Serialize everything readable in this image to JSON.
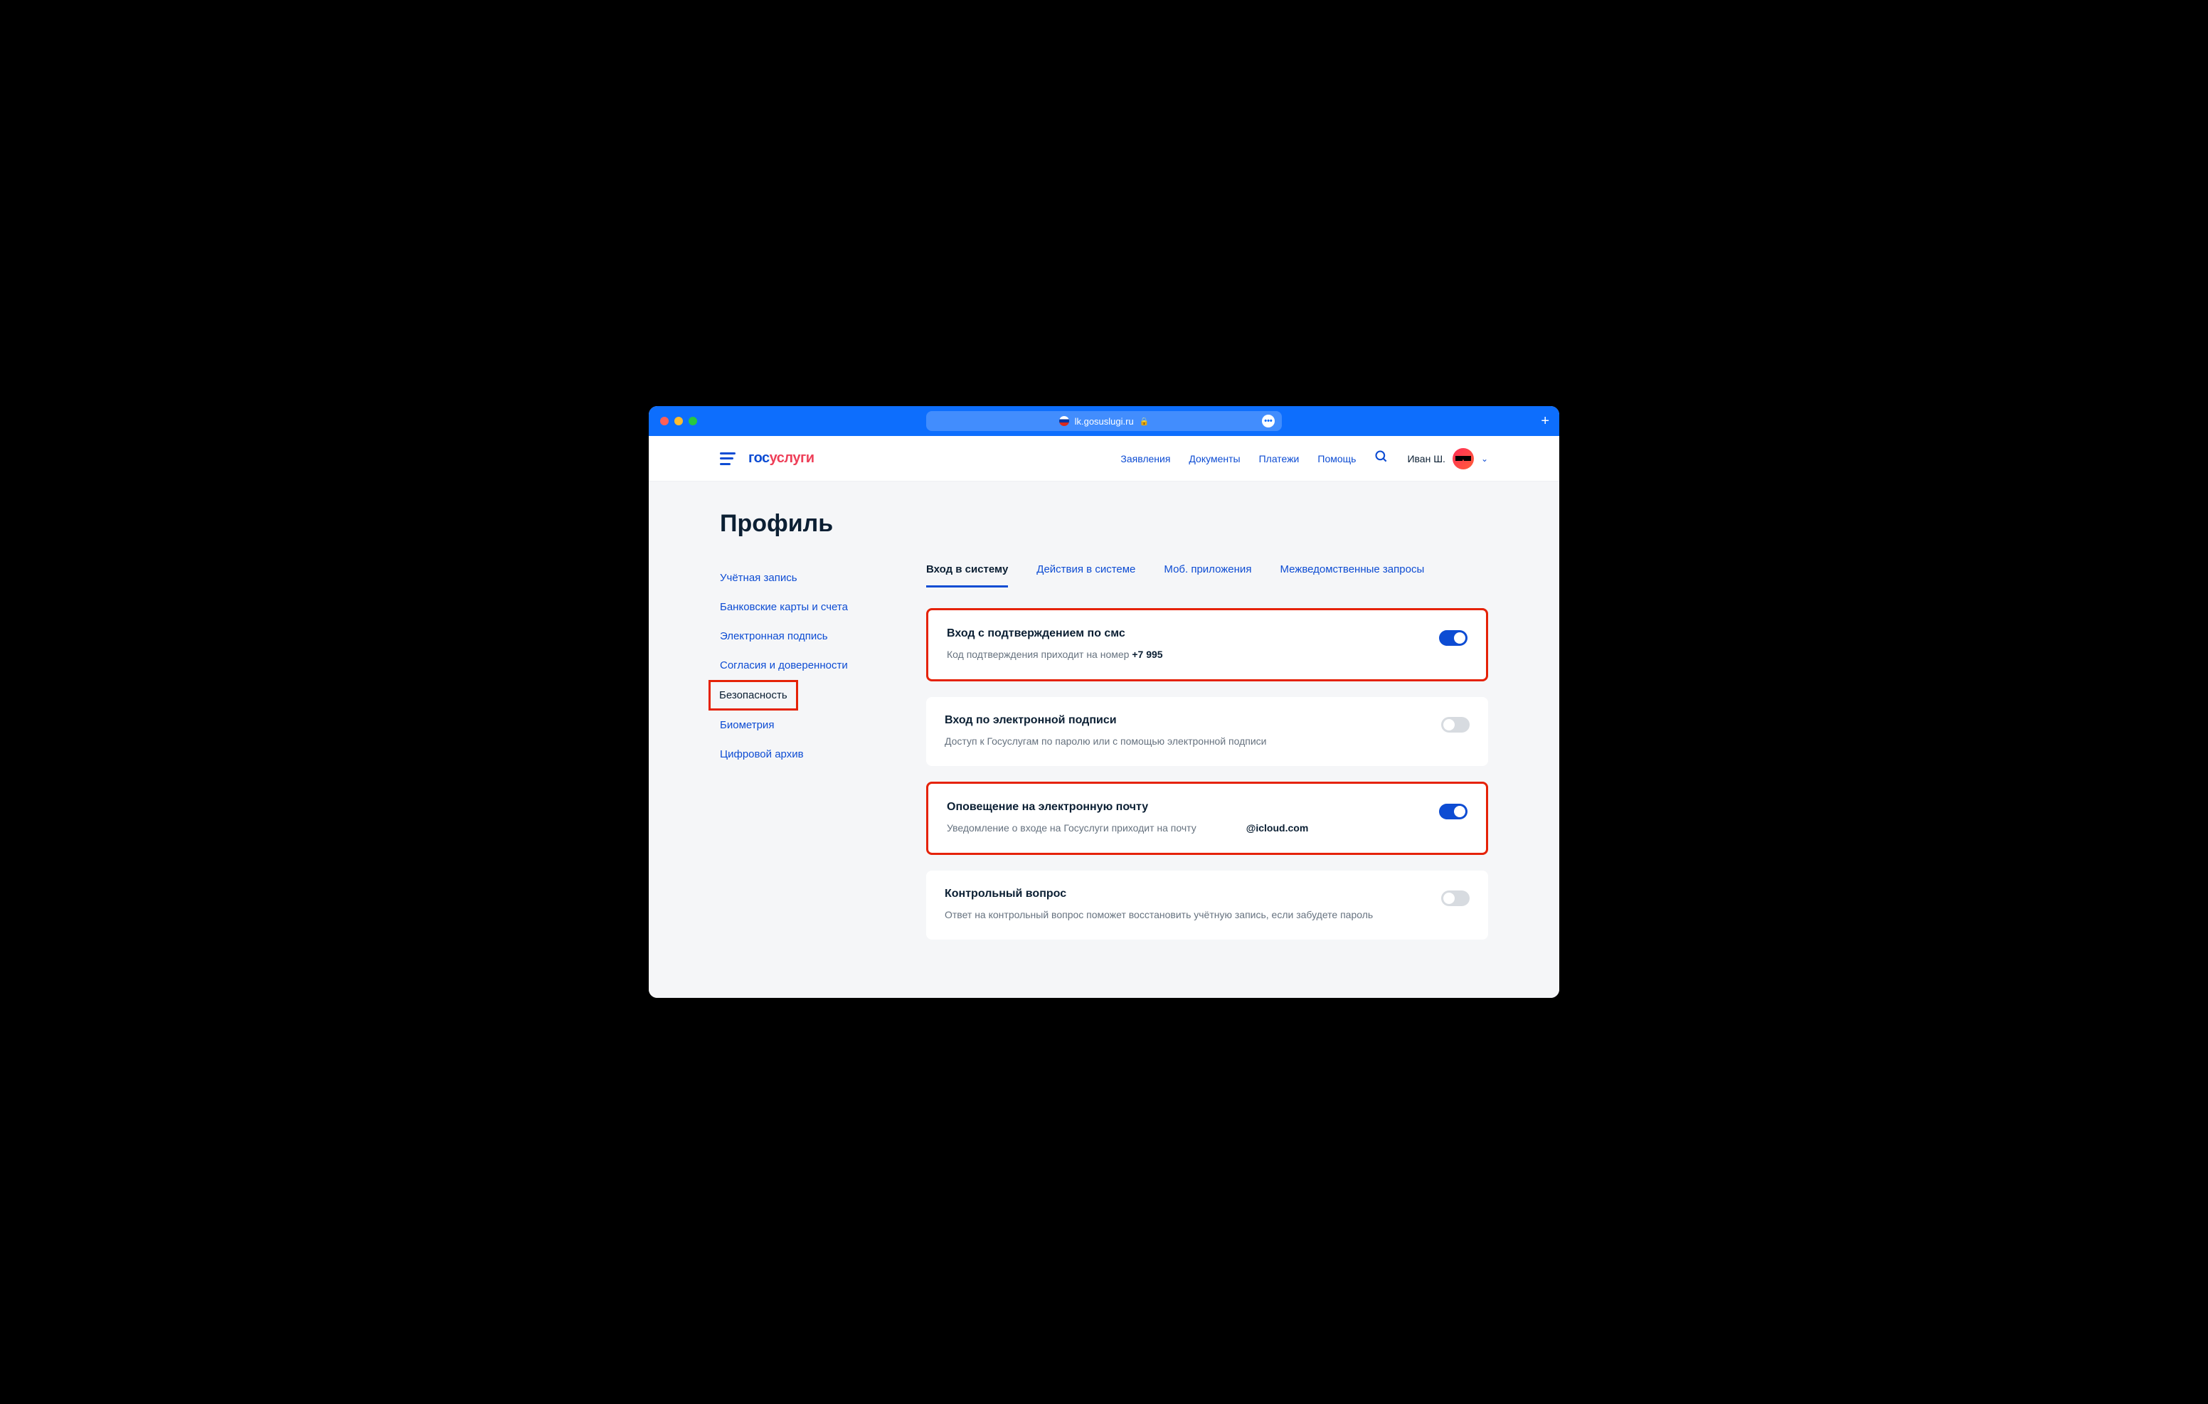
{
  "browser": {
    "url": "lk.gosuslugi.ru"
  },
  "header": {
    "logo": {
      "p1": "гос",
      "p2": "услуги",
      "p3": ""
    },
    "nav": [
      "Заявления",
      "Документы",
      "Платежи",
      "Помощь"
    ],
    "user_name": "Иван Ш."
  },
  "page": {
    "title": "Профиль"
  },
  "sidebar": {
    "items": [
      "Учётная запись",
      "Банковские карты и счета",
      "Электронная подпись",
      "Согласия и доверенности",
      "Безопасность",
      "Биометрия",
      "Цифровой архив"
    ],
    "active_index": 4
  },
  "tabs": {
    "items": [
      "Вход в систему",
      "Действия в системе",
      "Моб. приложения",
      "Межведомственные запросы"
    ],
    "active_index": 0
  },
  "cards": [
    {
      "title": "Вход с подтверждением по смс",
      "desc_prefix": "Код подтверждения приходит на номер ",
      "desc_strong": "+7 995",
      "desc_suffix": "",
      "toggle_on": true,
      "highlight": true
    },
    {
      "title": "Вход по электронной подписи",
      "desc_prefix": "Доступ к Госуслугам по паролю или с помощью электронной подписи",
      "desc_strong": "",
      "desc_suffix": "",
      "toggle_on": false,
      "highlight": false
    },
    {
      "title": "Оповещение на электронную почту",
      "desc_prefix": "Уведомление о входе на Госуслуги приходит на почту ",
      "desc_strong": "@icloud.com",
      "desc_suffix": "",
      "toggle_on": true,
      "highlight": true
    },
    {
      "title": "Контрольный вопрос",
      "desc_prefix": "Ответ на контрольный вопрос поможет восстановить учётную запись, если забудете пароль",
      "desc_strong": "",
      "desc_suffix": "",
      "toggle_on": false,
      "highlight": false
    }
  ]
}
